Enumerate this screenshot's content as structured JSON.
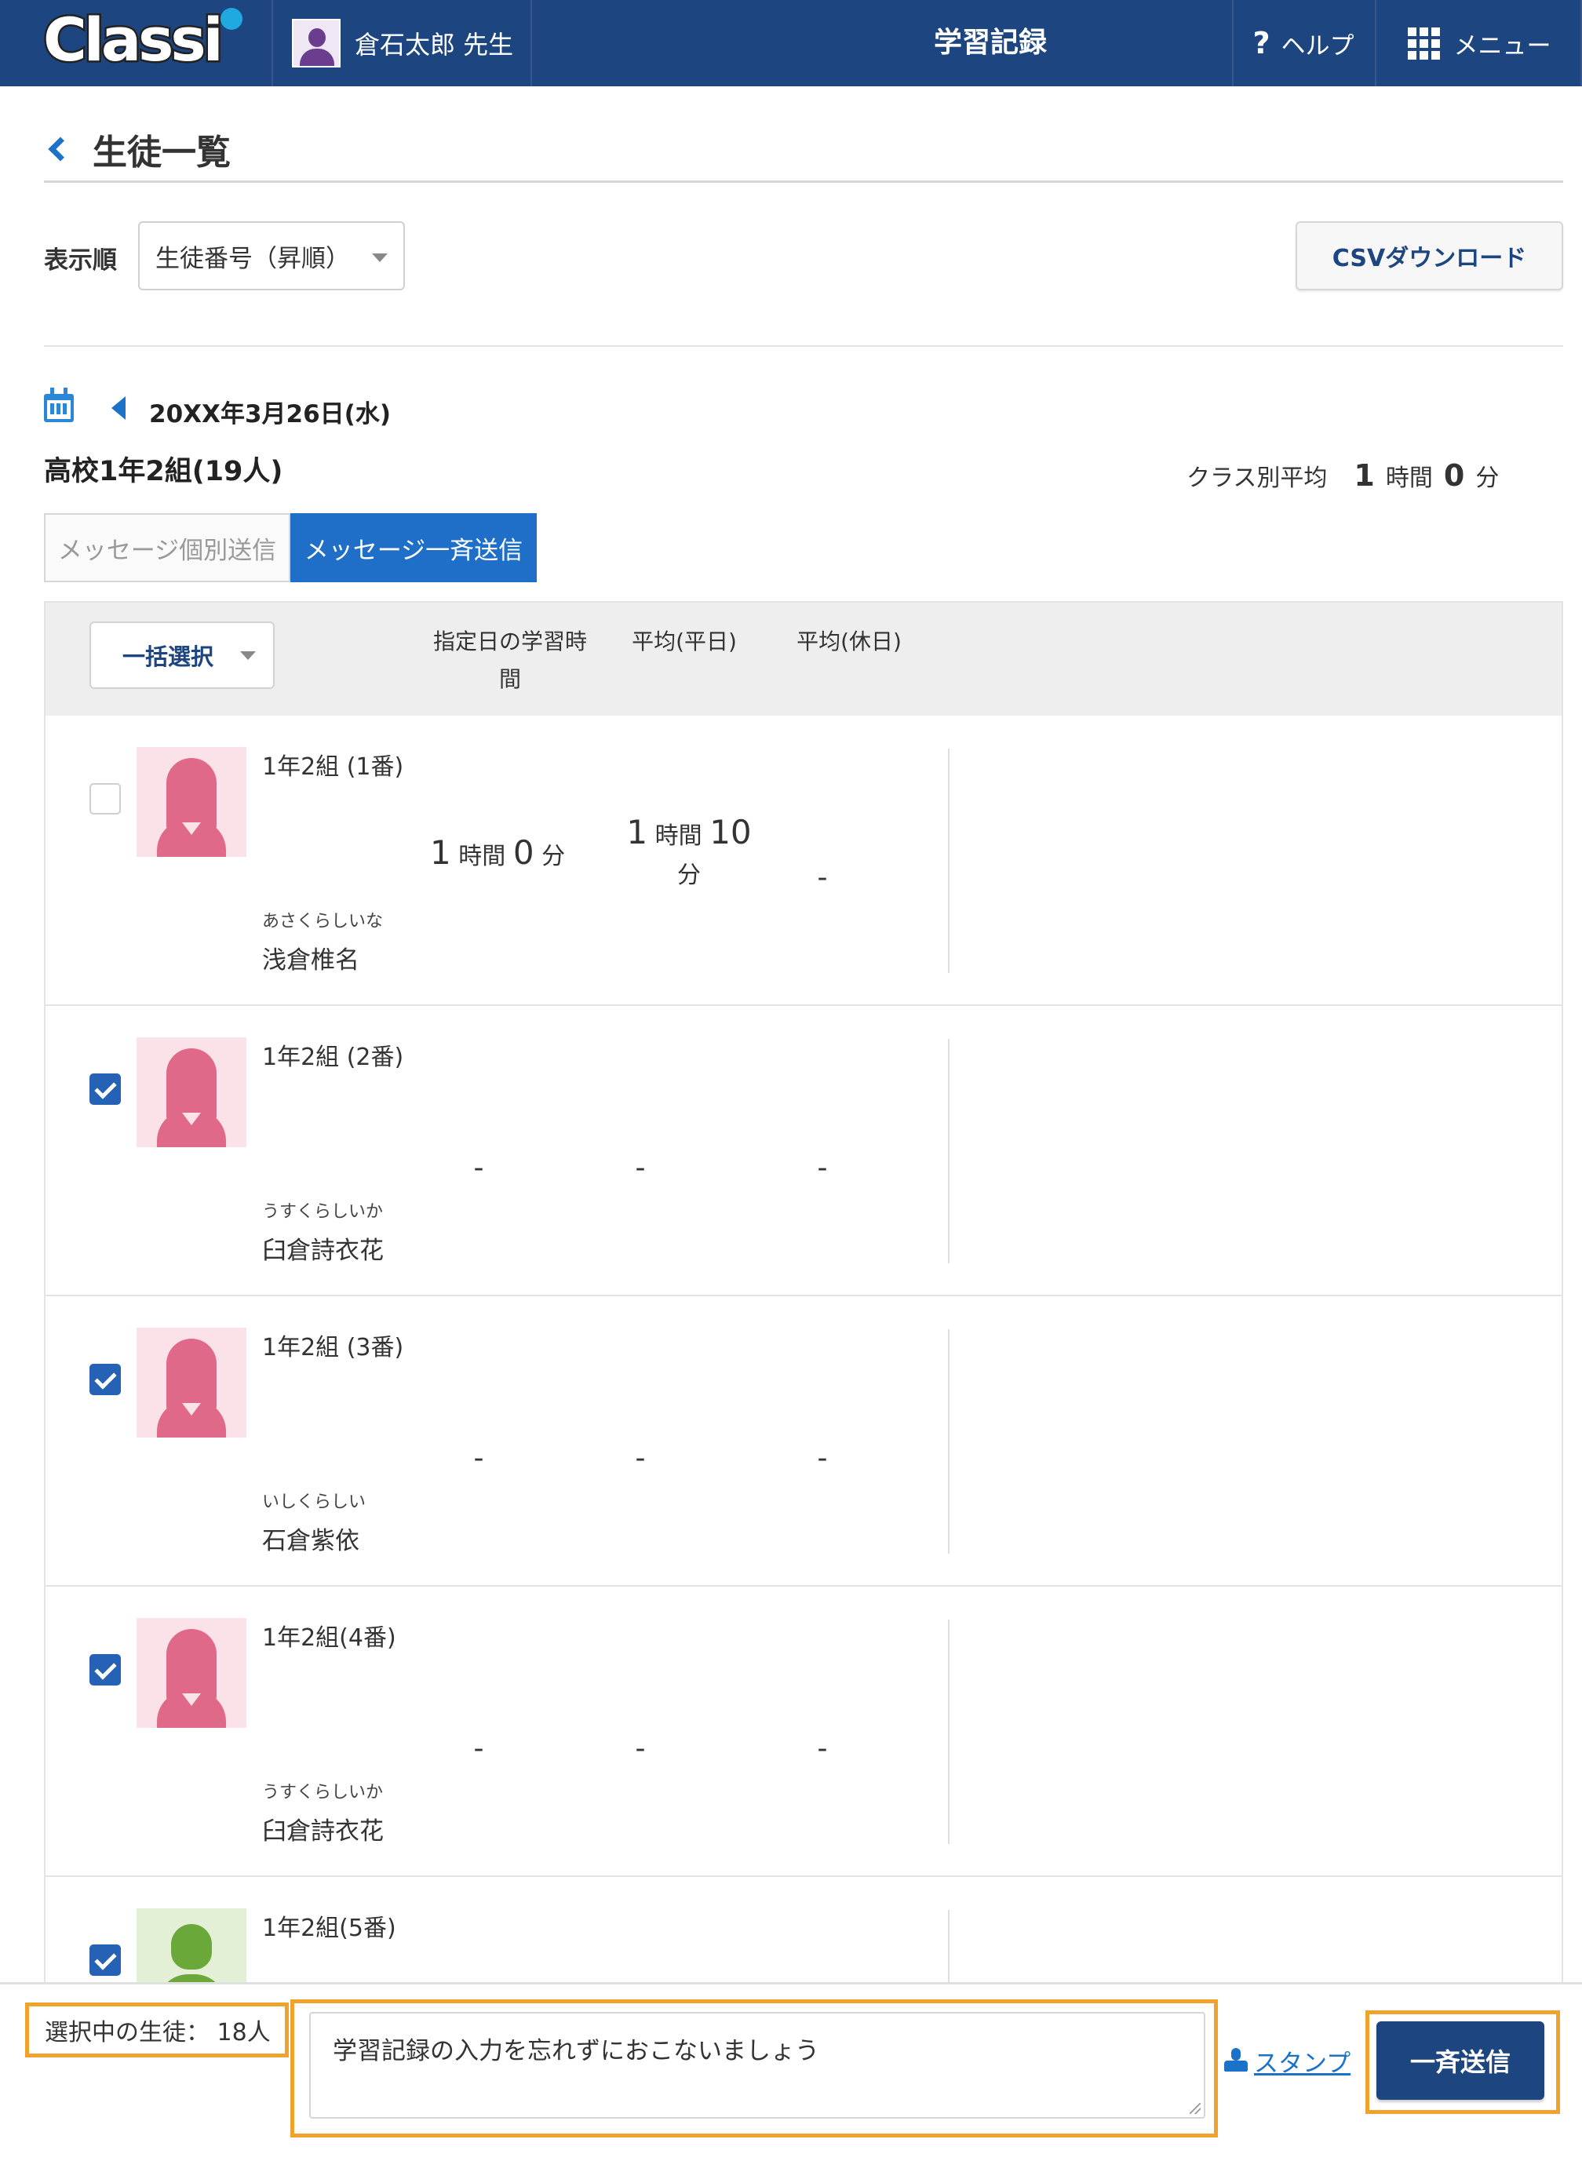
{
  "header": {
    "logo_text": "Classi",
    "user_name": "倉石太郎 先生",
    "title": "学習記録",
    "help_icon": "question-mark-icon",
    "help_label": "ヘルプ",
    "menu_icon": "grid-icon",
    "menu_label": "メニュー"
  },
  "page": {
    "back_icon": "chevron-left-icon",
    "title": "生徒一覧"
  },
  "sort": {
    "label": "表示順",
    "selected": "生徒番号（昇順）"
  },
  "csv_button": "CSVダウンロード",
  "date": {
    "calendar_icon": "calendar-icon",
    "prev_icon": "triangle-left-icon",
    "value": "20XX年3月26日(水)"
  },
  "class_info": {
    "name": "高校1年2組(19人)",
    "avg_label": "クラス別平均",
    "avg_hours": "1",
    "hours_unit": "時間",
    "avg_minutes": "0",
    "minutes_unit": "分"
  },
  "tabs": {
    "individual": "メッセージ個別送信",
    "bulk": "メッセージ一斉送信"
  },
  "table": {
    "bulk_select": "一括選択",
    "col_day": "指定日の学習時間",
    "col_weekday": "平均(平日)",
    "col_holiday": "平均(休日)"
  },
  "students": [
    {
      "checked": false,
      "class": "1年2組 (1番)",
      "kana": "あさくらしいな",
      "name": "浅倉椎名",
      "day_hours": "1",
      "day_minutes": "0",
      "weekday_hours": "1",
      "weekday_minutes": "10",
      "holiday": "-",
      "gender": "female"
    },
    {
      "checked": true,
      "class": "1年2組 (2番)",
      "kana": "うすくらしいか",
      "name": "臼倉詩衣花",
      "day": "-",
      "weekday": "-",
      "holiday": "-",
      "gender": "female"
    },
    {
      "checked": true,
      "class": "1年2組 (3番)",
      "kana": "いしくらしい",
      "name": "石倉紫依",
      "day": "-",
      "weekday": "-",
      "holiday": "-",
      "gender": "female"
    },
    {
      "checked": true,
      "class": "1年2組(4番)",
      "kana": "うすくらしいか",
      "name": "臼倉詩衣花",
      "day": "-",
      "weekday": "-",
      "holiday": "-",
      "gender": "female"
    },
    {
      "checked": true,
      "class": "1年2組(5番)",
      "gender": "male"
    }
  ],
  "units": {
    "hours": "時間",
    "minutes": "分"
  },
  "bottom": {
    "selected_label": "選択中の生徒：",
    "selected_count": "18人",
    "message": "学習記録の入力を忘れずにおこないましょう",
    "stamp_icon": "stamp-icon",
    "stamp_label": "スタンプ",
    "send_label": "一斉送信"
  }
}
